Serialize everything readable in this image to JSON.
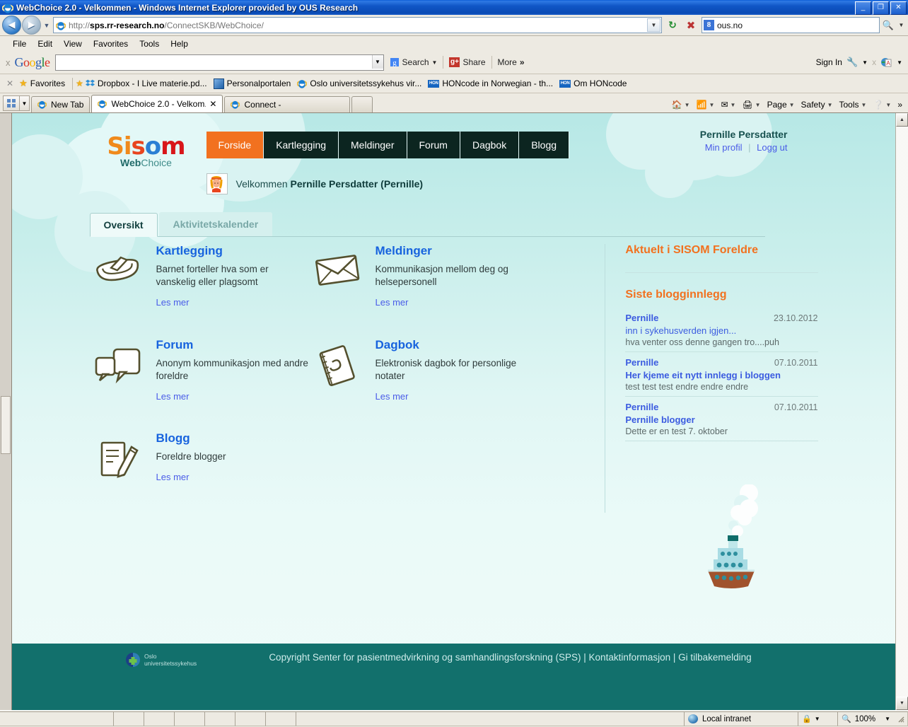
{
  "browser": {
    "title": "WebChoice 2.0 - Velkommen - Windows Internet Explorer provided by OUS Research",
    "window_buttons": {
      "minimize": "_",
      "restore": "❐",
      "close": "✕"
    },
    "address": {
      "protocol": "http://",
      "host": "sps.rr-research.no",
      "path": "/ConnectSKB/WebChoice/"
    },
    "search": {
      "value": "ous.no",
      "engine_badge": "8"
    },
    "menu": [
      "File",
      "Edit",
      "View",
      "Favorites",
      "Tools",
      "Help"
    ],
    "google_toolbar": {
      "close_label": "x",
      "logo": [
        "G",
        "o",
        "o",
        "g",
        "l",
        "e"
      ],
      "query": "",
      "search_label": "Search",
      "share_label": "Share",
      "more_label": "More",
      "more_chevron": "»",
      "sign_in": "Sign In",
      "close_x": "x"
    },
    "favorites_bar": {
      "label": "Favorites",
      "items": [
        {
          "label": "Dropbox - I Live materie.pd...",
          "icon": "dropbox-icon"
        },
        {
          "label": "Personalportalen",
          "icon": "portal-icon"
        },
        {
          "label": "Oslo universitetssykehus vir...",
          "icon": "ie-icon"
        },
        {
          "label": "HONcode in Norwegian - th...",
          "icon": "hon-icon"
        },
        {
          "label": "Om HONcode",
          "icon": "hon-icon"
        }
      ],
      "hon_badge": "HON"
    },
    "tabs": [
      {
        "label": "New Tab",
        "active": false,
        "closable": false
      },
      {
        "label": "WebChoice 2.0 - Velkom...",
        "active": true,
        "closable": true
      },
      {
        "label": "Connect -",
        "active": false,
        "closable": false
      }
    ],
    "command_bar": [
      "Page",
      "Safety",
      "Tools"
    ],
    "command_chevron": "»",
    "status": {
      "zone": "Local intranet",
      "zoom": "100%"
    }
  },
  "site": {
    "logo": {
      "letters": [
        "S",
        "i",
        "s",
        "o",
        "m"
      ],
      "tagline_bold": "Web",
      "tagline_rest": "Choice"
    },
    "nav": [
      {
        "label": "Forside",
        "active": true
      },
      {
        "label": "Kartlegging",
        "active": false
      },
      {
        "label": "Meldinger",
        "active": false
      },
      {
        "label": "Forum",
        "active": false
      },
      {
        "label": "Dagbok",
        "active": false
      },
      {
        "label": "Blogg",
        "active": false
      }
    ],
    "welcome": {
      "prefix": "Velkommen",
      "name": "Pernille Persdatter (Pernille)"
    },
    "user": {
      "name": "Pernille Persdatter",
      "profile_link": "Min profil",
      "logout_link": "Logg ut",
      "separator": "|"
    },
    "page_tabs": [
      {
        "label": "Oversikt",
        "active": true
      },
      {
        "label": "Aktivitetskalender",
        "active": false
      }
    ],
    "features": [
      {
        "title": "Kartlegging",
        "desc": "Barnet forteller hva som er vanskelig eller plagsomt",
        "link": "Les mer",
        "icon": "boat-icon"
      },
      {
        "title": "Meldinger",
        "desc": "Kommunikasjon mellom deg og helsepersonell",
        "link": "Les mer",
        "icon": "envelope-icon"
      },
      {
        "title": "Forum",
        "desc": "Anonym kommunikasjon med andre foreldre",
        "link": "Les mer",
        "icon": "speech-bubbles-icon"
      },
      {
        "title": "Dagbok",
        "desc": "Elektronisk dagbok for personlige notater",
        "link": "Les mer",
        "icon": "notebook-icon"
      },
      {
        "title": "Blogg",
        "desc": "Foreldre blogger",
        "link": "Les mer",
        "icon": "notepad-pencil-icon"
      }
    ],
    "sidebar": {
      "heading": "Aktuelt i SISOM Foreldre",
      "blog_heading": "Siste blogginnlegg",
      "posts": [
        {
          "author": "Pernille",
          "date": "23.10.2012",
          "title": "inn i sykehusverden igjen...",
          "excerpt": "hva venter oss denne gangen tro....puh",
          "bold_title": false
        },
        {
          "author": "Pernille",
          "date": "07.10.2011",
          "title": "Her kjeme eit nytt innlegg i bloggen",
          "excerpt": "test test test endre endre endre",
          "bold_title": true
        },
        {
          "author": "Pernille",
          "date": "07.10.2011",
          "title": "Pernille blogger",
          "excerpt": "Dette er en test 7. oktober",
          "bold_title": true
        }
      ]
    },
    "footer": {
      "org_line1": "Oslo",
      "org_line2": "universitetssykehus",
      "text": "Copyright Senter for pasientmedvirkning og samhandlingsforskning (SPS) | Kontaktinformasjon | Gi tilbakemelding"
    }
  },
  "colors": {
    "nav_active": "#f2711f",
    "nav_bg": "#0c2520",
    "link": "#4a5ce8",
    "heading": "#1763de",
    "accent_orange": "#f2711f",
    "footer_bg": "#12706c",
    "page_bg": "#e3f7f6"
  }
}
